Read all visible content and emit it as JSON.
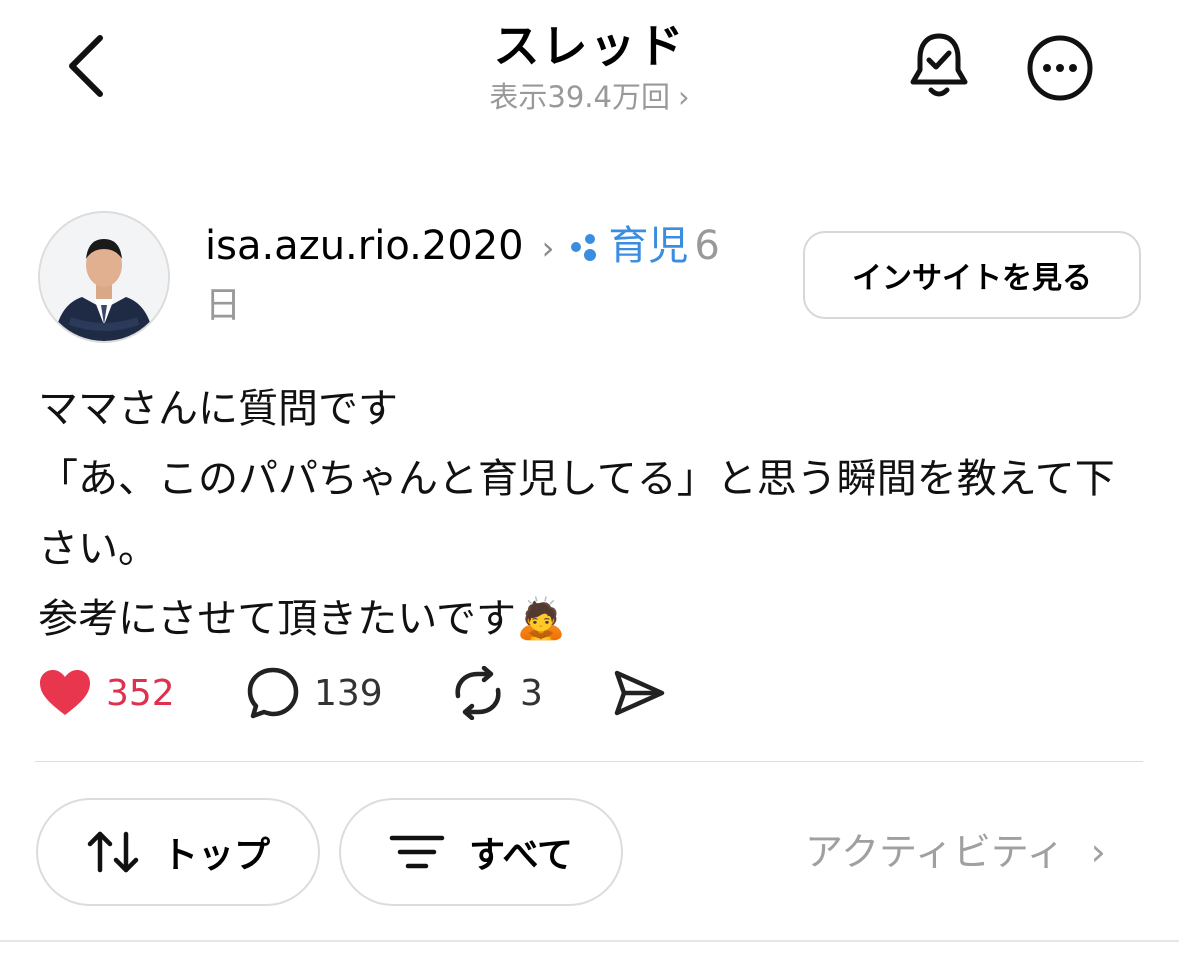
{
  "header": {
    "title": "スレッド",
    "views": "表示39.4万回",
    "back_icon": "chevron-left-icon",
    "bell_icon": "bell-check-icon",
    "more_icon": "more-horizontal-icon"
  },
  "post": {
    "username": "isa.azu.rio.2020",
    "topic": "育児",
    "time_prefix": "6",
    "time_suffix": "日",
    "insight_button": "インサイトを見る",
    "lines": [
      "ママさんに質問です",
      "「あ、このパパちゃんと育児してる」と思う瞬間を教えて下",
      "さい。",
      "参考にさせて頂きたいです🙇"
    ],
    "likes": "352",
    "replies": "139",
    "reposts": "3"
  },
  "filters": {
    "top_label": "トップ",
    "all_label": "すべて",
    "activity_label": "アクティビティ"
  },
  "colors": {
    "like": "#e03050",
    "topic": "#3b8de0",
    "muted": "#999999"
  }
}
